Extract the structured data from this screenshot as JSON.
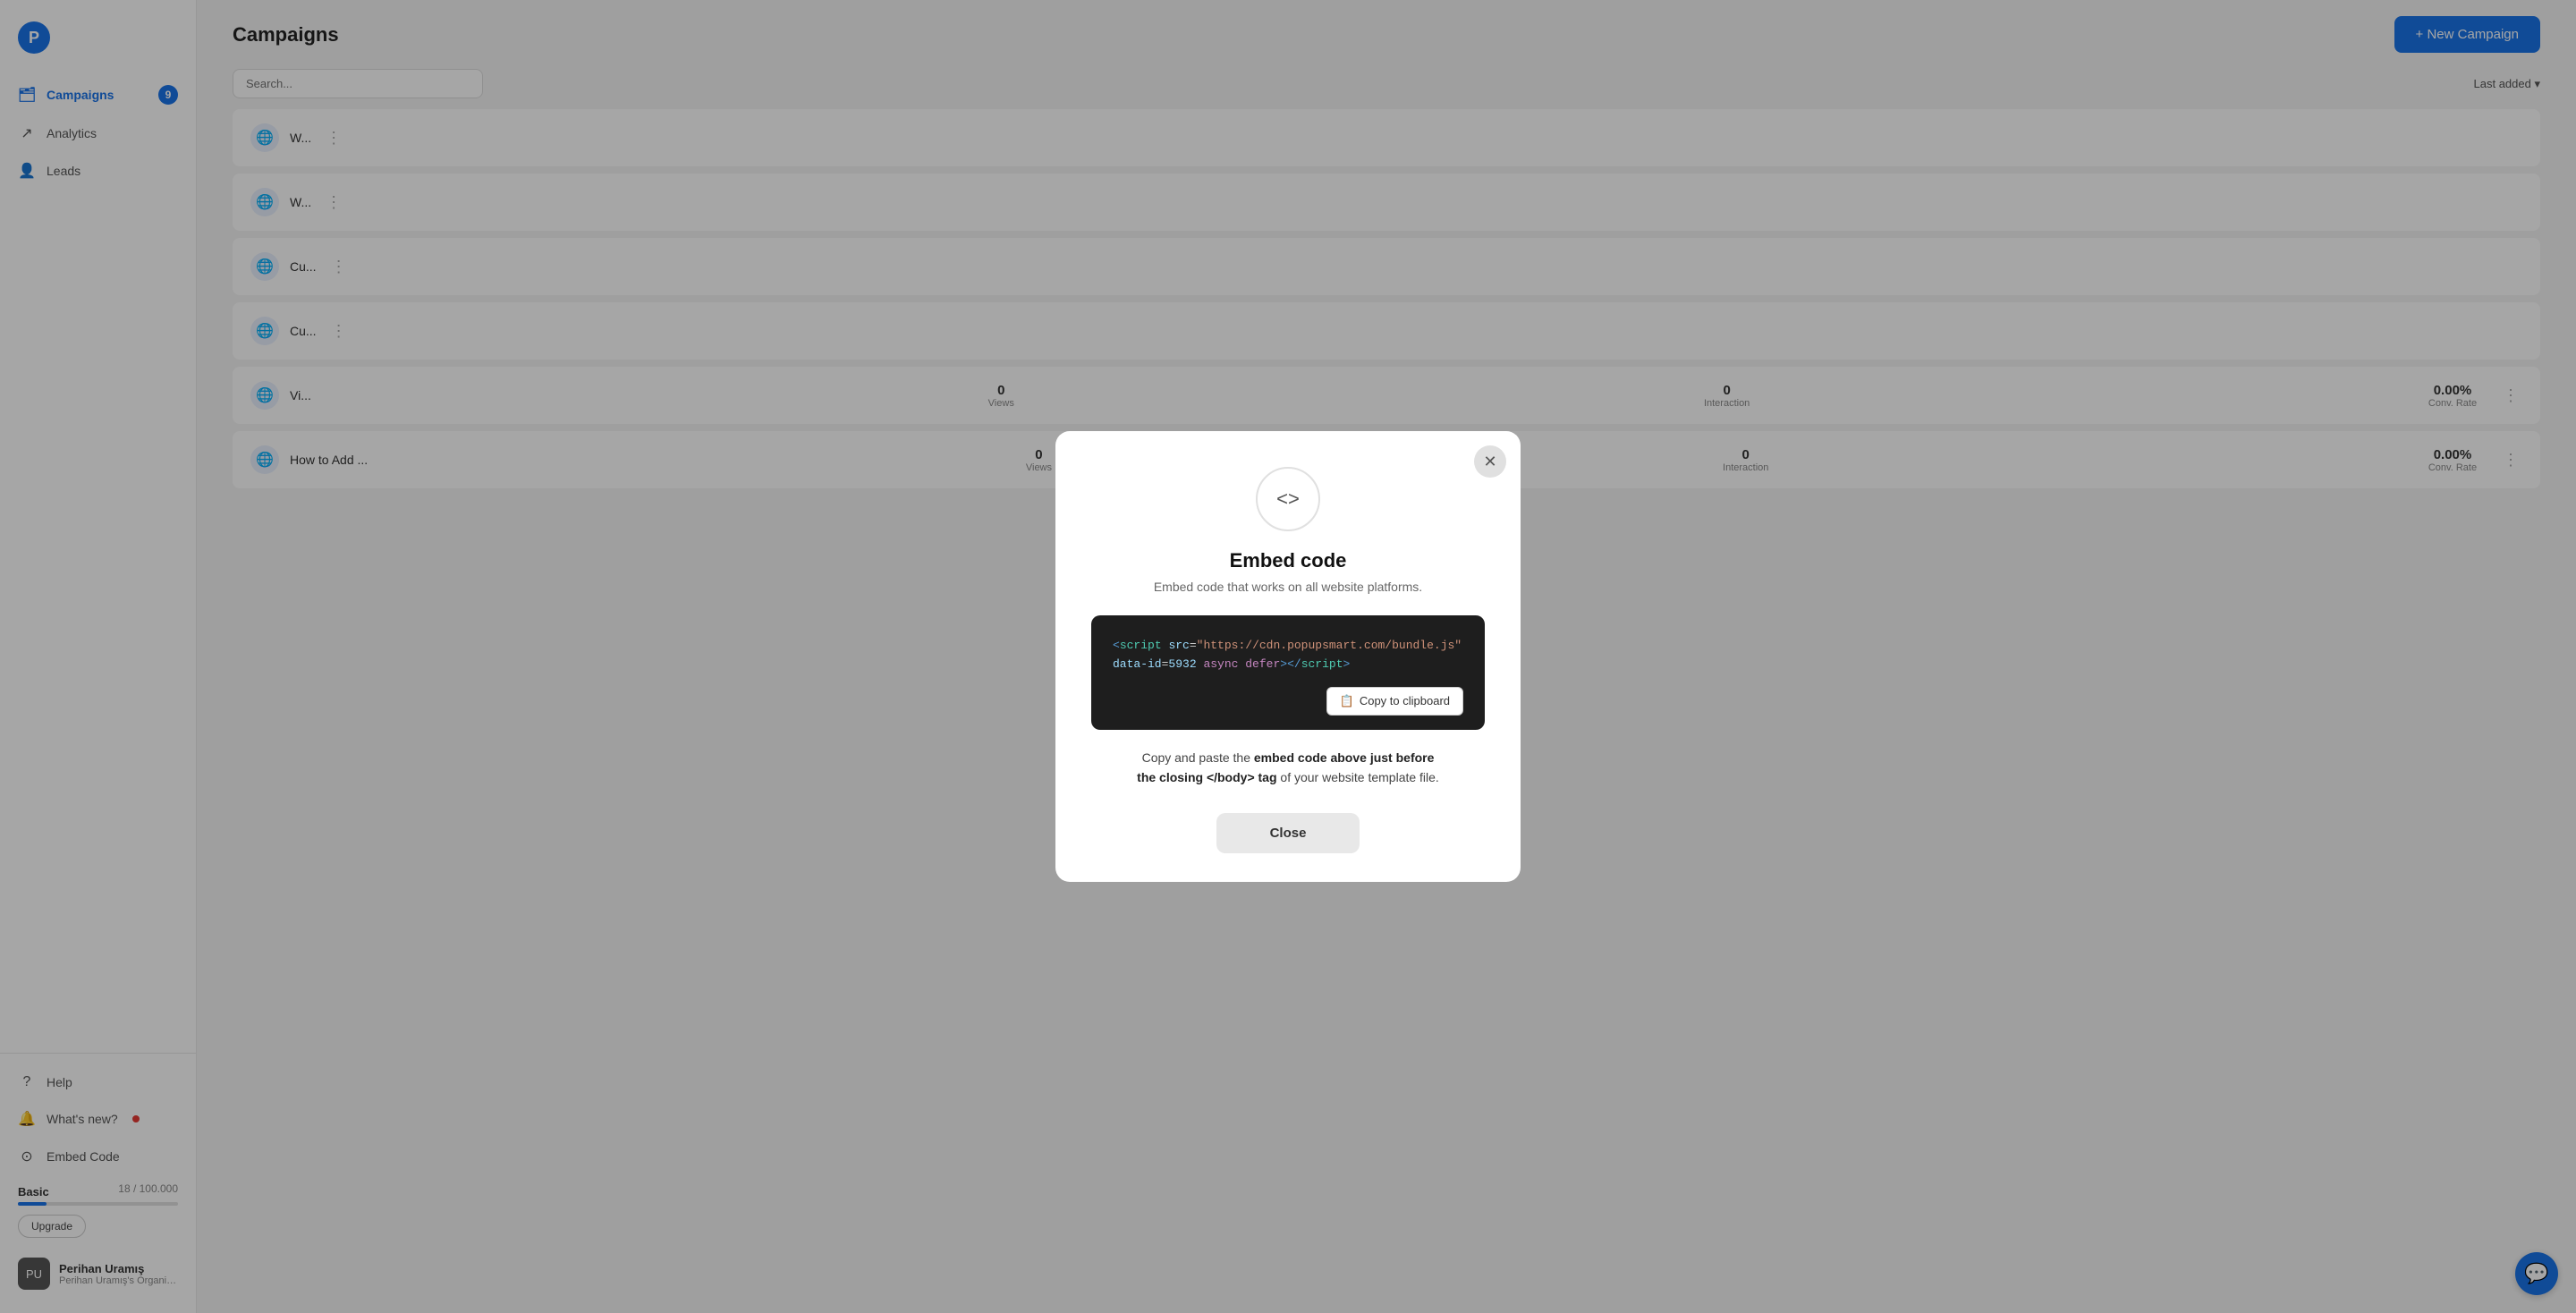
{
  "sidebar": {
    "logo_icon": "◯",
    "nav_items": [
      {
        "id": "campaigns",
        "label": "Campaigns",
        "icon": "🗂",
        "badge": "9",
        "active": true
      },
      {
        "id": "analytics",
        "label": "Analytics",
        "icon": "↗",
        "badge": null,
        "active": false
      },
      {
        "id": "leads",
        "label": "Leads",
        "icon": "👤",
        "badge": null,
        "active": false
      }
    ],
    "bottom_items": [
      {
        "id": "help",
        "label": "Help",
        "icon": "?"
      },
      {
        "id": "whats-new",
        "label": "What's new?",
        "icon": "🔔",
        "dot": true
      },
      {
        "id": "embed-code",
        "label": "Embed Code",
        "icon": "⊙"
      }
    ],
    "plan": {
      "title": "Basic",
      "usage": "18 / 100.000",
      "fill_percent": 18,
      "upgrade_label": "Upgrade"
    },
    "user": {
      "name": "Perihan Uramış",
      "org": "Perihan Uramış's Organization",
      "initials": "PU"
    }
  },
  "header": {
    "title": "Campaigns",
    "new_campaign_label": "+ New Campaign"
  },
  "campaign_list": {
    "search_placeholder": "Search...",
    "sort_label": "Last added ▾",
    "rows": [
      {
        "id": 1,
        "icon": "🌐",
        "name": "W..."
      },
      {
        "id": 2,
        "icon": "🌐",
        "name": "W..."
      },
      {
        "id": 3,
        "icon": "🌐",
        "name": "Cu..."
      },
      {
        "id": 4,
        "icon": "🌐",
        "name": "Cu..."
      },
      {
        "id": 5,
        "icon": "🌐",
        "name": "Vi...",
        "views": "0",
        "interaction": "0",
        "conv_rate": "0.00%",
        "views_label": "Views",
        "interaction_label": "Interaction",
        "conv_label": "Conv. Rate"
      },
      {
        "id": 6,
        "icon": "🌐",
        "name": "How to Add ...",
        "views": "0",
        "interaction": "0",
        "conv_rate": "0.00%",
        "views_label": "Views",
        "interaction_label": "Interaction",
        "conv_label": "Conv. Rate"
      }
    ]
  },
  "modal": {
    "code_icon": "<>",
    "title": "Embed code",
    "subtitle": "Embed code that works on all website platforms.",
    "code_line1": "<script src=\"https://cdn.popupsmart.com/bundle.j",
    "code_line2": "s\" data-id=5932 async defer></script>",
    "copy_button_label": "Copy to clipboard",
    "copy_icon": "📋",
    "instructions_plain": "Copy and paste the ",
    "instructions_bold1": "embed code above just before the closing </body> tag",
    "instructions_plain2": " of your website template file.",
    "close_label": "Close"
  }
}
